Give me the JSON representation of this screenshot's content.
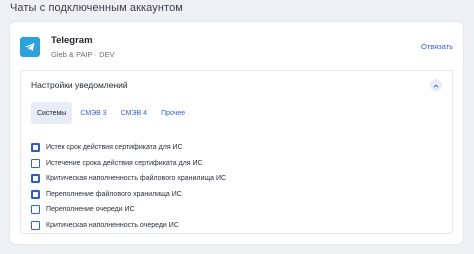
{
  "page": {
    "title": "Чаты с подключенным аккаунтом"
  },
  "account": {
    "name": "Telegram",
    "subtitle": "Gleb & PAIP · DEV",
    "unlink_label": "Отвязать"
  },
  "settings": {
    "title": "Настройки уведомлений",
    "tabs": [
      {
        "label": "Системы",
        "active": true
      },
      {
        "label": "СМЭВ 3",
        "active": false
      },
      {
        "label": "СМЭВ 4",
        "active": false
      },
      {
        "label": "Прочее",
        "active": false
      }
    ],
    "items": [
      {
        "label": "Истек срок действия сертификата для ИС",
        "checked": true
      },
      {
        "label": "Истечение срока действия сертификата для ИС",
        "checked": false
      },
      {
        "label": "Критическая наполненность файлового хранилища ИС",
        "checked": true
      },
      {
        "label": "Переполнение файлового хранилища ИС",
        "checked": true
      },
      {
        "label": "Переполнение очереди ИС",
        "checked": false
      },
      {
        "label": "Критическая наполненность очереди ИС",
        "checked": false
      }
    ]
  },
  "colors": {
    "accent": "#2b63d9",
    "telegram": "#2aa3dc",
    "tab_active_bg": "#e7ecf7"
  }
}
